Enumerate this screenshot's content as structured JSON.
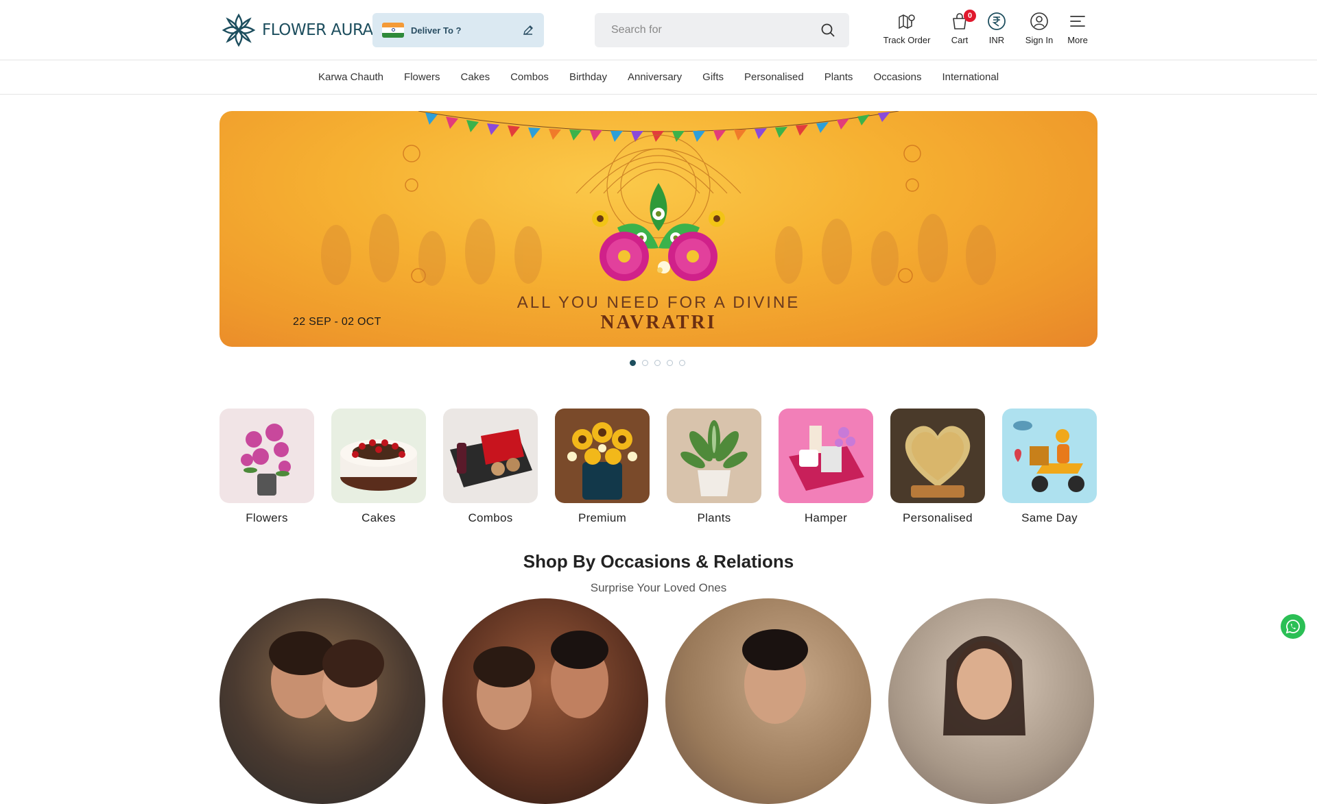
{
  "header": {
    "logo_text": "FLOWER AURA",
    "deliver_label": "Deliver To ?",
    "search_placeholder": "Search for",
    "actions": [
      {
        "label": "Track Order",
        "icon": "map-pin-icon"
      },
      {
        "label": "Cart",
        "icon": "cart-icon",
        "badge": "0"
      },
      {
        "label": "INR",
        "icon": "rupee-icon"
      },
      {
        "label": "Sign In",
        "icon": "user-icon"
      },
      {
        "label": "More",
        "icon": "menu-icon"
      }
    ]
  },
  "nav": {
    "items": [
      "Karwa Chauth",
      "Flowers",
      "Cakes",
      "Combos",
      "Birthday",
      "Anniversary",
      "Gifts",
      "Personalised",
      "Plants",
      "Occasions",
      "International"
    ]
  },
  "banner": {
    "date": "22 SEP - 02 OCT",
    "line1": "ALL YOU NEED FOR A DIVINE",
    "line2": "NAVRATRI",
    "slide_count": 5,
    "active_slide": 1
  },
  "categories": [
    {
      "label": "Flowers"
    },
    {
      "label": "Cakes"
    },
    {
      "label": "Combos"
    },
    {
      "label": "Premium"
    },
    {
      "label": "Plants"
    },
    {
      "label": "Hamper"
    },
    {
      "label": "Personalised"
    },
    {
      "label": "Same Day"
    }
  ],
  "occasions": {
    "title": "Shop By Occasions & Relations",
    "subtitle": "Surprise Your Loved Ones"
  },
  "colors": {
    "brand": "#1d4e5e",
    "badge": "#e0182d",
    "whatsapp": "#2bbf55",
    "banner": "#f6b132"
  }
}
